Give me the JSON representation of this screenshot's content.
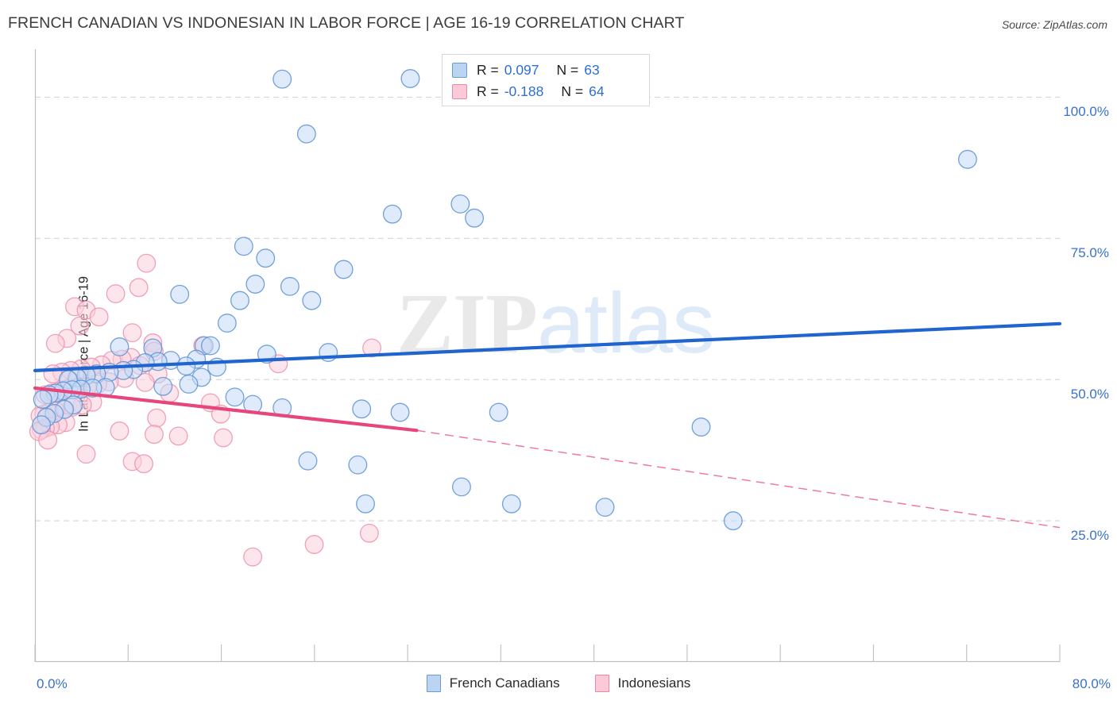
{
  "header": {
    "title": "FRENCH CANADIAN VS INDONESIAN IN LABOR FORCE | AGE 16-19 CORRELATION CHART",
    "source": "Source: ZipAtlas.com"
  },
  "watermark": {
    "part1": "ZIP",
    "part2": "atlas"
  },
  "stats": {
    "blue": {
      "r_label": "R =",
      "r_value": "0.097",
      "n_label": "N =",
      "n_value": "63"
    },
    "pink": {
      "r_label": "R =",
      "r_value": "-0.188",
      "n_label": "N =",
      "n_value": "64"
    }
  },
  "axes": {
    "y_title": "In Labor Force | Age 16-19",
    "y_ticks": [
      "100.0%",
      "75.0%",
      "50.0%",
      "25.0%"
    ],
    "x_min_label": "0.0%",
    "x_max_label": "80.0%"
  },
  "legend": {
    "items": [
      {
        "label": "French Canadians",
        "color": "#bad4f2"
      },
      {
        "label": "Indonesians",
        "color": "#fbc9d8"
      }
    ]
  },
  "colors": {
    "blue_fill": "#c5daf5",
    "blue_stroke": "#5b92d6",
    "pink_fill": "#fbd0dd",
    "pink_stroke": "#ef90ad",
    "blue_line": "#1f64cf",
    "pink_line": "#e8457a",
    "grid": "#d9d9d9",
    "axis": "#bfbfbf",
    "tick_text": "#3a72c8"
  },
  "chart_data": {
    "type": "scatter",
    "title": "FRENCH CANADIAN VS INDONESIAN IN LABOR FORCE | AGE 16-19 CORRELATION CHART",
    "xlabel": "",
    "ylabel": "In Labor Force | Age 16-19",
    "xlim": [
      0,
      80
    ],
    "ylim": [
      0,
      108.5
    ],
    "x_ticks": [
      0,
      80
    ],
    "y_ticks": [
      25,
      50,
      75,
      100
    ],
    "grid": "horizontal-dashed",
    "legend_position": "bottom-center",
    "series": [
      {
        "name": "French Canadians",
        "color": "#c5daf5",
        "r": 0.097,
        "n": 63,
        "trend": {
          "style": "solid",
          "x0": 0.0,
          "y0": 51.6,
          "x1": 80.0,
          "y1": 59.9
        },
        "points": [
          [
            19.3,
            103.2
          ],
          [
            29.3,
            103.3
          ],
          [
            21.2,
            93.5
          ],
          [
            72.8,
            89.0
          ],
          [
            27.9,
            79.3
          ],
          [
            33.2,
            81.1
          ],
          [
            34.3,
            78.6
          ],
          [
            16.3,
            73.6
          ],
          [
            18.0,
            71.5
          ],
          [
            24.1,
            69.5
          ],
          [
            17.2,
            66.9
          ],
          [
            19.9,
            66.5
          ],
          [
            21.6,
            64.0
          ],
          [
            16.0,
            64.0
          ],
          [
            11.3,
            65.1
          ],
          [
            15.0,
            60.0
          ],
          [
            9.2,
            55.6
          ],
          [
            6.6,
            55.8
          ],
          [
            13.2,
            56.0
          ],
          [
            13.7,
            56.0
          ],
          [
            22.9,
            54.8
          ],
          [
            18.1,
            54.5
          ],
          [
            12.6,
            53.6
          ],
          [
            10.6,
            53.4
          ],
          [
            9.6,
            53.2
          ],
          [
            8.6,
            53.0
          ],
          [
            11.8,
            52.4
          ],
          [
            14.2,
            52.2
          ],
          [
            7.7,
            51.8
          ],
          [
            6.9,
            51.6
          ],
          [
            5.8,
            51.3
          ],
          [
            4.8,
            51.0
          ],
          [
            4.0,
            50.7
          ],
          [
            3.3,
            50.3
          ],
          [
            2.6,
            50.0
          ],
          [
            13.0,
            50.4
          ],
          [
            12.0,
            49.2
          ],
          [
            10.0,
            48.8
          ],
          [
            5.5,
            48.6
          ],
          [
            4.5,
            48.5
          ],
          [
            3.6,
            48.3
          ],
          [
            2.9,
            48.2
          ],
          [
            2.2,
            48.0
          ],
          [
            1.6,
            47.6
          ],
          [
            1.1,
            47.3
          ],
          [
            15.6,
            46.9
          ],
          [
            17.0,
            45.6
          ],
          [
            19.3,
            45.0
          ],
          [
            25.5,
            44.8
          ],
          [
            28.5,
            44.2
          ],
          [
            36.2,
            44.2
          ],
          [
            3.0,
            45.5
          ],
          [
            2.3,
            44.7
          ],
          [
            1.5,
            44.0
          ],
          [
            0.9,
            43.3
          ],
          [
            0.6,
            46.5
          ],
          [
            0.5,
            42.0
          ],
          [
            52.0,
            41.6
          ],
          [
            21.3,
            35.6
          ],
          [
            25.2,
            34.9
          ],
          [
            44.5,
            27.4
          ],
          [
            54.5,
            25.0
          ],
          [
            33.3,
            31.0
          ],
          [
            25.8,
            28.0
          ],
          [
            37.2,
            28.0
          ]
        ]
      },
      {
        "name": "Indonesians",
        "color": "#fbd0dd",
        "r": -0.188,
        "n": 64,
        "trend": {
          "style": "solid-then-dashed",
          "x0": 0.0,
          "y0": 48.5,
          "x_break": 29.8,
          "y_break": 41.0,
          "x1": 80.0,
          "y1": 23.8
        },
        "points": [
          [
            8.7,
            70.6
          ],
          [
            8.1,
            66.3
          ],
          [
            6.3,
            65.2
          ],
          [
            3.1,
            62.9
          ],
          [
            4.0,
            62.3
          ],
          [
            5.0,
            61.1
          ],
          [
            3.5,
            59.5
          ],
          [
            7.6,
            58.3
          ],
          [
            2.5,
            57.3
          ],
          [
            1.6,
            56.4
          ],
          [
            9.2,
            56.5
          ],
          [
            26.3,
            55.6
          ],
          [
            9.3,
            55.0
          ],
          [
            19.0,
            52.8
          ],
          [
            13.1,
            56.0
          ],
          [
            7.5,
            53.9
          ],
          [
            6.8,
            53.6
          ],
          [
            6.0,
            53.4
          ],
          [
            8.2,
            52.5
          ],
          [
            5.2,
            52.6
          ],
          [
            4.4,
            52.2
          ],
          [
            3.6,
            51.9
          ],
          [
            2.8,
            51.6
          ],
          [
            2.1,
            51.3
          ],
          [
            1.4,
            51.0
          ],
          [
            9.6,
            51.0
          ],
          [
            7.0,
            50.2
          ],
          [
            5.8,
            49.6
          ],
          [
            4.9,
            49.2
          ],
          [
            4.1,
            48.8
          ],
          [
            3.3,
            48.5
          ],
          [
            2.6,
            48.2
          ],
          [
            1.9,
            47.9
          ],
          [
            1.3,
            47.6
          ],
          [
            0.8,
            47.3
          ],
          [
            8.6,
            49.5
          ],
          [
            10.5,
            47.6
          ],
          [
            4.5,
            46.0
          ],
          [
            3.7,
            45.5
          ],
          [
            2.9,
            45.1
          ],
          [
            2.2,
            44.8
          ],
          [
            1.6,
            44.5
          ],
          [
            1.1,
            44.2
          ],
          [
            0.7,
            43.9
          ],
          [
            0.4,
            43.6
          ],
          [
            13.7,
            45.9
          ],
          [
            14.5,
            43.9
          ],
          [
            9.5,
            43.2
          ],
          [
            2.4,
            42.4
          ],
          [
            1.8,
            42.0
          ],
          [
            1.2,
            41.7
          ],
          [
            0.8,
            41.4
          ],
          [
            0.5,
            41.1
          ],
          [
            0.3,
            40.8
          ],
          [
            6.6,
            40.9
          ],
          [
            9.3,
            40.3
          ],
          [
            11.2,
            40.0
          ],
          [
            14.7,
            39.7
          ],
          [
            1.0,
            39.3
          ],
          [
            4.0,
            36.8
          ],
          [
            7.6,
            35.5
          ],
          [
            8.5,
            35.1
          ],
          [
            26.1,
            22.8
          ],
          [
            21.8,
            20.8
          ],
          [
            17.0,
            18.6
          ]
        ]
      }
    ]
  }
}
